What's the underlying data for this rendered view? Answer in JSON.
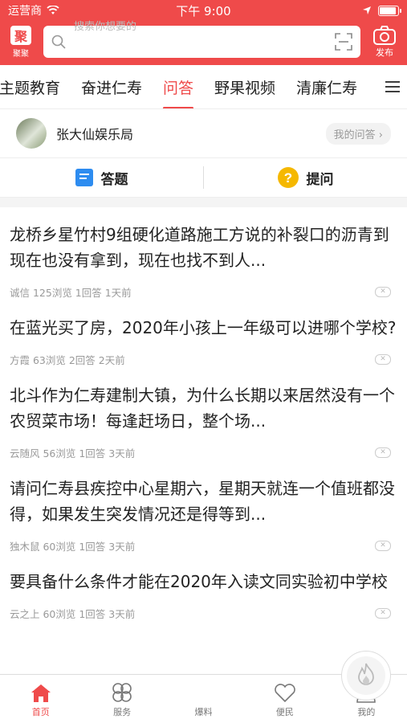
{
  "status_bar": {
    "carrier": "运营商",
    "time": "下午 9:00"
  },
  "header": {
    "logo_label": "聚聚",
    "logo_char": "聚",
    "search_placeholder": "搜索你想要的",
    "camera_label": "发布"
  },
  "tabs": [
    {
      "label": "主题教育",
      "active": false
    },
    {
      "label": "奋进仁寿",
      "active": false
    },
    {
      "label": "问答",
      "active": true
    },
    {
      "label": "野果视频",
      "active": false
    },
    {
      "label": "清廉仁寿",
      "active": false
    }
  ],
  "user": {
    "name": "张大仙娱乐局",
    "my_answers": "我的问答 ›"
  },
  "actions": {
    "answer_label": "答题",
    "ask_label": "提问",
    "ask_icon_char": "?"
  },
  "questions": [
    {
      "text": "龙桥乡星竹村9组硬化道路施工方说的补裂口的沥青到现在也没有拿到，现在也找不到人...",
      "meta": "诚信 125浏览 1回答 1天前"
    },
    {
      "text": "在蓝光买了房，2020年小孩上一年级可以进哪个学校?",
      "meta": "方霞 63浏览 2回答 2天前"
    },
    {
      "text": "北斗作为仁寿建制大镇，为什么长期以来居然没有一个农贸菜市场！每逢赶场日，整个场...",
      "meta": "云随风 56浏览 1回答 3天前"
    },
    {
      "text": "请问仁寿县疾控中心星期六，星期天就连一个值班都没得，如果发生突发情况还是得等到...",
      "meta": "独木鼠 60浏览 1回答 3天前"
    },
    {
      "text": "要具备什么条件才能在2020年入读文同实验初中学校",
      "meta": "云之上 60浏览 1回答 3天前"
    }
  ],
  "tabbar": [
    {
      "label": "首页",
      "icon": "home-icon",
      "active": true
    },
    {
      "label": "服务",
      "icon": "clover-icon",
      "active": false
    },
    {
      "label": "爆料",
      "icon": "flame-icon",
      "active": false
    },
    {
      "label": "便民",
      "icon": "heart-icon",
      "active": false
    },
    {
      "label": "我的",
      "icon": "person-icon",
      "active": false
    }
  ],
  "colors": {
    "brand": "#ef4a4a",
    "ask_icon": "#f5b800",
    "answer_icon": "#2d8cf0"
  }
}
